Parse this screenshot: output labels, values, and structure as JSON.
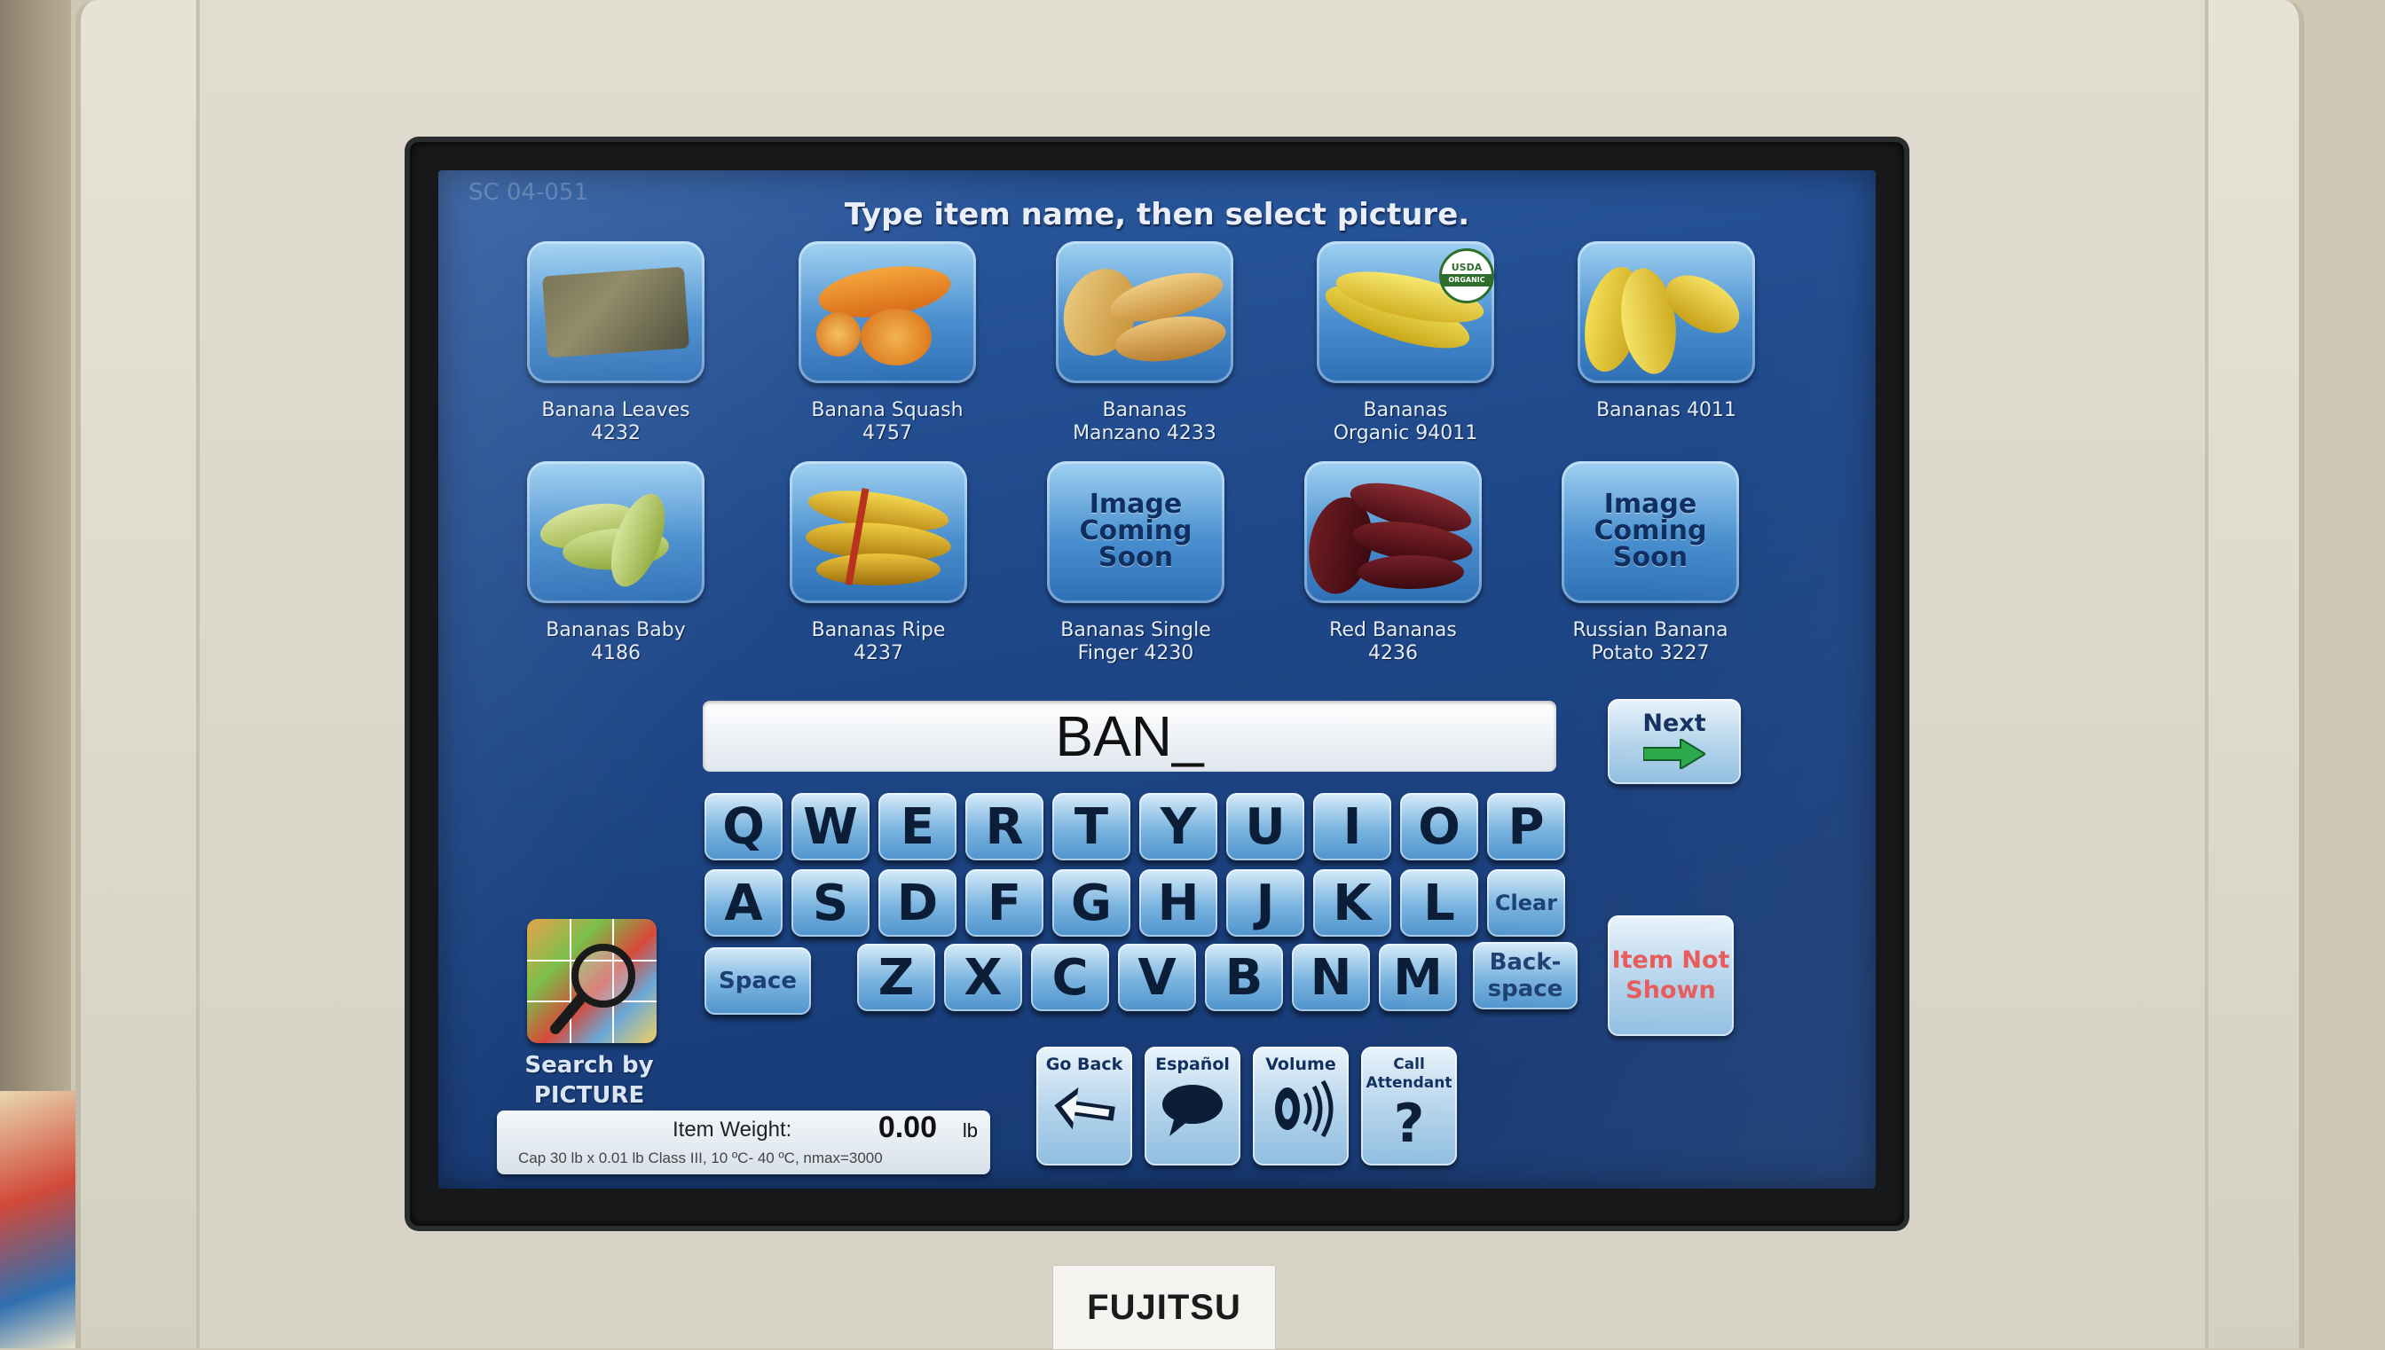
{
  "screen": {
    "screen_id": "SC 04-051",
    "instruction": "Type item name, then select picture."
  },
  "products": [
    {
      "name_line1": "Banana Leaves",
      "name_line2": "4232",
      "image": "banana-leaves"
    },
    {
      "name_line1": "Banana Squash",
      "name_line2": "4757",
      "image": "banana-squash"
    },
    {
      "name_line1": "Bananas",
      "name_line2": "Manzano  4233",
      "image": "bananas-manzano"
    },
    {
      "name_line1": "Bananas",
      "name_line2": "Organic  94011",
      "image": "bananas-organic"
    },
    {
      "name_line1": "Bananas  4011",
      "name_line2": "",
      "image": "bananas"
    },
    {
      "name_line1": "Bananas  Baby",
      "name_line2": "4186",
      "image": "bananas-baby"
    },
    {
      "name_line1": "Bananas  Ripe",
      "name_line2": "4237",
      "image": "bananas-ripe"
    },
    {
      "name_line1": "Bananas  Single",
      "name_line2": "Finger  4230",
      "image": "image-coming-soon"
    },
    {
      "name_line1": "Red Bananas",
      "name_line2": "4236",
      "image": "red-bananas"
    },
    {
      "name_line1": "Russian Banana",
      "name_line2": "Potato  3227",
      "image": "image-coming-soon"
    }
  ],
  "placeholder_image": {
    "line1": "Image",
    "line2": "Coming",
    "line3": "Soon"
  },
  "organic_badge": {
    "line1": "USDA",
    "line2": "ORGANIC"
  },
  "search": {
    "value": "BAN_"
  },
  "next_button": {
    "label": "Next",
    "icon": "arrow-right-icon"
  },
  "keyboard": {
    "row1": [
      "Q",
      "W",
      "E",
      "R",
      "T",
      "Y",
      "U",
      "I",
      "O",
      "P"
    ],
    "row2": [
      "A",
      "S",
      "D",
      "F",
      "G",
      "H",
      "J",
      "K",
      "L"
    ],
    "row3": [
      "Z",
      "X",
      "C",
      "V",
      "B",
      "N",
      "M"
    ],
    "clear": "Clear",
    "space": "Space",
    "backspace_line1": "Back-",
    "backspace_line2": "space"
  },
  "item_not_shown": {
    "line1": "Item Not",
    "line2": "Shown",
    "color": "#e85858"
  },
  "search_by_picture": {
    "line1": "Search by",
    "line2": "PICTURE",
    "icon": "magnifier-icon"
  },
  "weight": {
    "label": "Item Weight:",
    "value": "0.00",
    "unit": "lb",
    "capacity": "Cap 30 lb x 0.01 lb Class III, 10 ºC- 40 ºC, nmax=3000"
  },
  "function_buttons": [
    {
      "label": "Go Back",
      "icon": "back-arrow-icon"
    },
    {
      "label": "Español",
      "icon": "speech-bubble-icon"
    },
    {
      "label": "Volume",
      "icon": "speaker-icon"
    },
    {
      "label_line1": "Call",
      "label_line2": "Attendant",
      "icon": "question-mark-icon"
    }
  ],
  "vendor_label": "FUJITSU",
  "colors": {
    "screen_bg": "#204a8c",
    "key": "#79b3df",
    "next_arrow": "#2aa84a"
  }
}
